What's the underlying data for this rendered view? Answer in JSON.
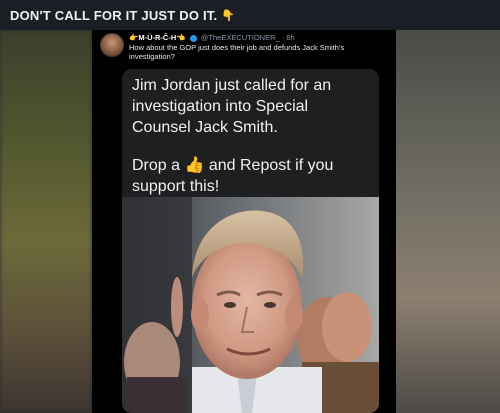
{
  "header": {
    "title": "DON'T CALL FOR IT JUST DO IT.",
    "emoji": "👇"
  },
  "tweet": {
    "name": "👉M-Ü-R-Č-H👈",
    "handle": "@TheEXECUTIONER_",
    "time": "· 8h",
    "text": "How about the GOP just does their job and defunds Jack Smith's investigation?"
  },
  "card": {
    "line1": "Jim Jordan just called for an investigation into Special Counsel Jack Smith.",
    "line2_prefix": "Drop a",
    "line2_emoji": "👍",
    "line2_suffix": "and Repost if you support this!"
  },
  "colors": {
    "header_bg": "#1b1f25",
    "verified": "#1d9bf0",
    "card_bg": "#1e1f21"
  },
  "icons": {
    "verified": "verified-badge-icon",
    "pointer": "pointing-down-icon"
  }
}
